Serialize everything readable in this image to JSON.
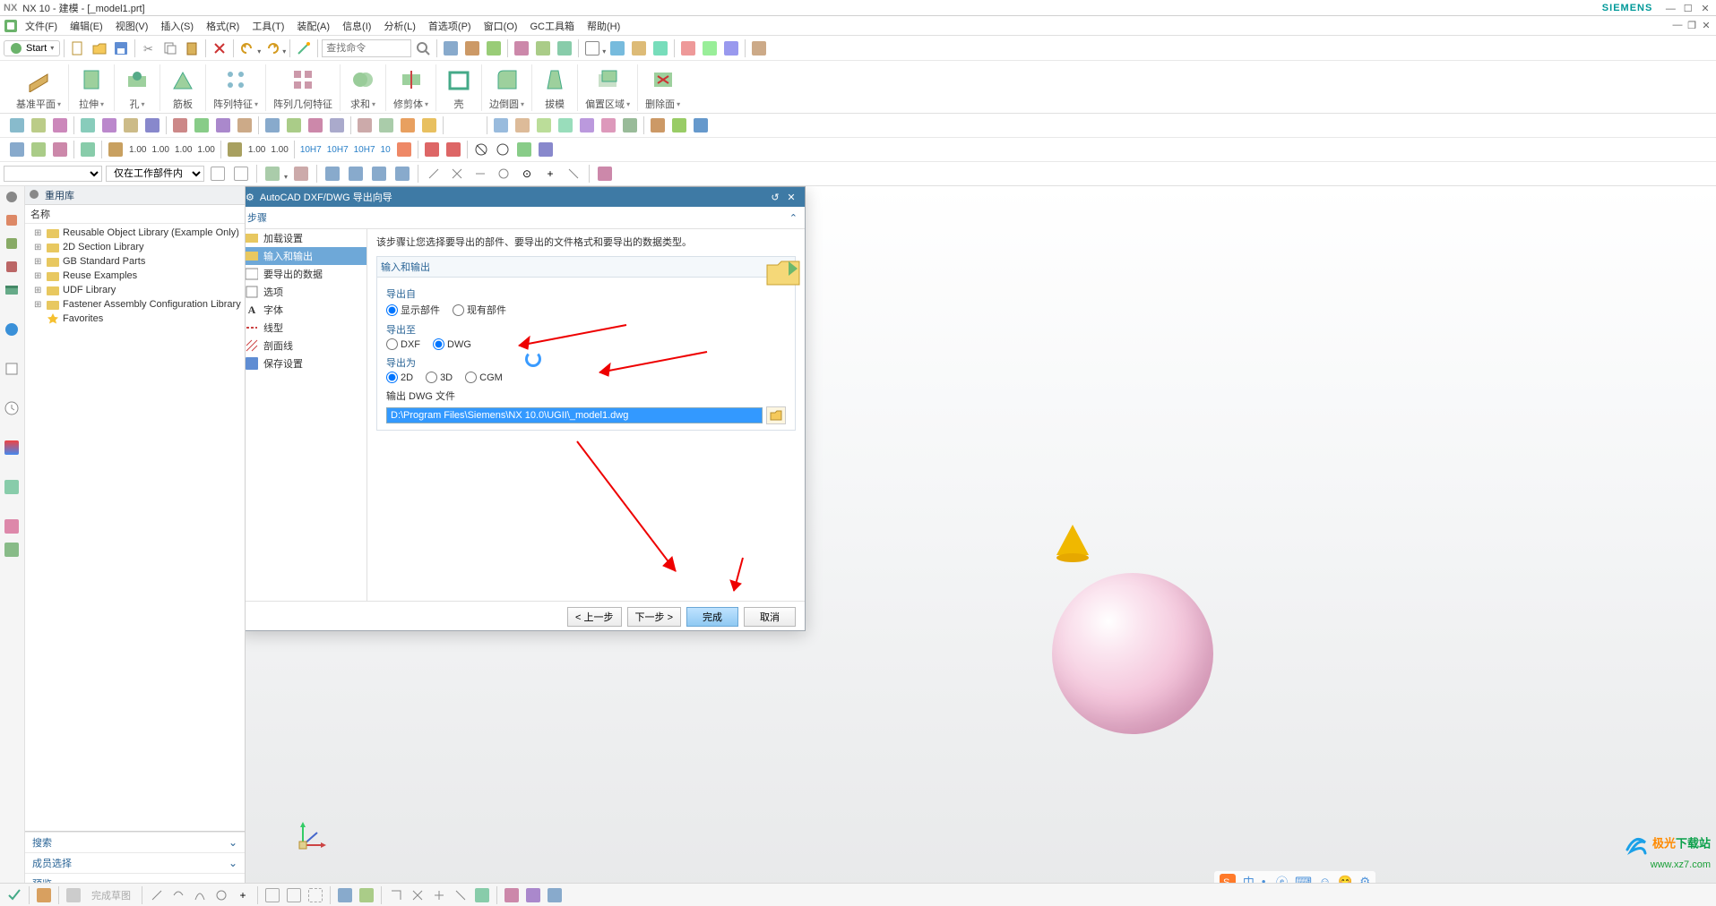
{
  "title": {
    "app": "NX",
    "text": "NX 10 - 建模 - [_model1.prt]",
    "brand": "SIEMENS"
  },
  "menu": {
    "items": [
      "文件(F)",
      "编辑(E)",
      "视图(V)",
      "插入(S)",
      "格式(R)",
      "工具(T)",
      "装配(A)",
      "信息(I)",
      "分析(L)",
      "首选项(P)",
      "窗口(O)",
      "GC工具箱",
      "帮助(H)"
    ]
  },
  "toolbar1": {
    "start": "Start",
    "search_placeholder": "查找命令"
  },
  "ribbon": {
    "items": [
      {
        "label": "基准平面"
      },
      {
        "label": "拉伸"
      },
      {
        "label": "孔"
      },
      {
        "label": "筋板"
      },
      {
        "label": "阵列特征"
      },
      {
        "label": "阵列几何特征"
      },
      {
        "label": "求和"
      },
      {
        "label": "修剪体"
      },
      {
        "label": "壳"
      },
      {
        "label": "边倒圆"
      },
      {
        "label": "拔模"
      },
      {
        "label": "偏置区域"
      },
      {
        "label": "删除面"
      }
    ]
  },
  "tb_numbers": [
    "1.00",
    "1.00",
    "1.00",
    "1.00",
    "1.00",
    "1.00",
    "10H7",
    "10H7",
    "10H7",
    "10"
  ],
  "filter": {
    "combo": "仅在工作部件内"
  },
  "reuse": {
    "header": "重用库",
    "col": "名称",
    "items": [
      "Reusable Object Library (Example Only)",
      "2D Section Library",
      "GB Standard Parts",
      "Reuse Examples",
      "UDF Library",
      "Fastener Assembly Configuration Library",
      "Favorites"
    ],
    "sections": [
      "搜索",
      "成员选择",
      "预览"
    ]
  },
  "dialog": {
    "title": "AutoCAD DXF/DWG 导出向导",
    "steps_label": "步骤",
    "nav": [
      "加载设置",
      "输入和输出",
      "要导出的数据",
      "选项",
      "字体",
      "线型",
      "剖面线",
      "保存设置"
    ],
    "nav_selected_index": 1,
    "description": "该步骤让您选择要导出的部件、要导出的文件格式和要导出的数据类型。",
    "io_header": "输入和输出",
    "export_from": {
      "label": "导出自",
      "opt1": "显示部件",
      "opt2": "现有部件",
      "selected": "显示部件"
    },
    "export_to": {
      "label": "导出至",
      "opt1": "DXF",
      "opt2": "DWG",
      "selected": "DWG"
    },
    "export_as": {
      "label": "导出为",
      "opt1": "2D",
      "opt2": "3D",
      "opt3": "CGM",
      "selected": "2D"
    },
    "output_file": {
      "label": "输出 DWG 文件",
      "value": "D:\\Program Files\\Siemens\\NX 10.0\\UGII\\_model1.dwg"
    },
    "buttons": {
      "back": "< 上一步",
      "next": "下一步 >",
      "finish": "完成",
      "cancel": "取消"
    }
  },
  "ime": {
    "items": [
      "中",
      "•,",
      "ⓔ",
      "⌨",
      "☺",
      "😊",
      "⚙"
    ]
  },
  "watermark": {
    "line1a": "极光",
    "line1b": "下载站",
    "line2": "www.xz7.com"
  }
}
